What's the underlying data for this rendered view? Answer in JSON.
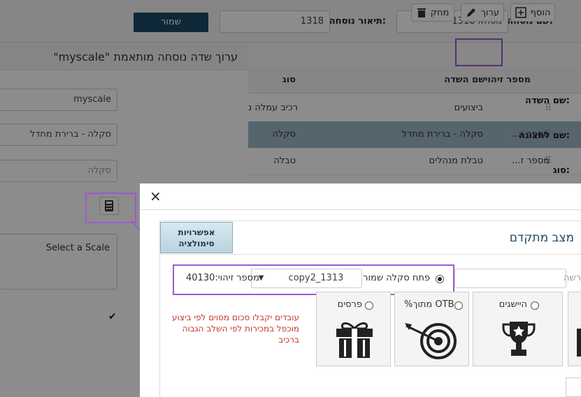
{
  "header": {
    "version_name_label": "שם נוסחה:",
    "version_name_value": "נוסחא 1318",
    "version_desc_label": "תיאור נוסחה:",
    "version_desc_value": "1318",
    "save_label": "שמור"
  },
  "toolbar": {
    "add_label": "הוסף",
    "edit_label": "ערוך",
    "delete_label": "מחק"
  },
  "table": {
    "headers": [
      "מספר זיהוי",
      "שם השדה",
      "סוג"
    ],
    "rows": [
      {
        "id": "",
        "name": "ביצועים",
        "type": "רכיב עמלה נ"
      },
      {
        "id": "מספר ז...",
        "name": "סקלה - ברירת מחדל",
        "type": "סקלה"
      },
      {
        "id": "מספר ז...",
        "name": "טבלת מנהלים",
        "type": "טבלה"
      }
    ]
  },
  "panel": {
    "title": "ערוך שדה נוסחה מותאמת \"myscale\"",
    "field_name_label": "שם השדה:",
    "field_name_value": "myscale",
    "display_name_label": "שם לתצוגה:",
    "display_name_value": "סקלה - ברירת מחדל",
    "type_label": "סוג:",
    "type_placeholder": "סקלה",
    "scale_text": "Select a Scale"
  },
  "modal": {
    "close": "×",
    "section_title": "מצב מתקדם",
    "sim_button": "אפשרויות סימולציה",
    "open_saved_label": "פתח סקלה שמורה",
    "saved_scale_value": "copy2_1313",
    "id_label": "מספר זיהוי:",
    "id_value": "40130",
    "new_label": "רשה",
    "options": [
      "היישגים",
      "%מתוך OTB",
      "פרסים"
    ],
    "description": "עובדים יקבלו סכום מסוים לפי ביצוע מוכפל במכירות לפי השלב הגבוה ברכיב"
  },
  "colors": {
    "save_button": "#1b4965",
    "highlight": "#9b59d0",
    "selected_row": "#9bb7c6",
    "title": "#1b4965",
    "description": "#c0392b"
  }
}
